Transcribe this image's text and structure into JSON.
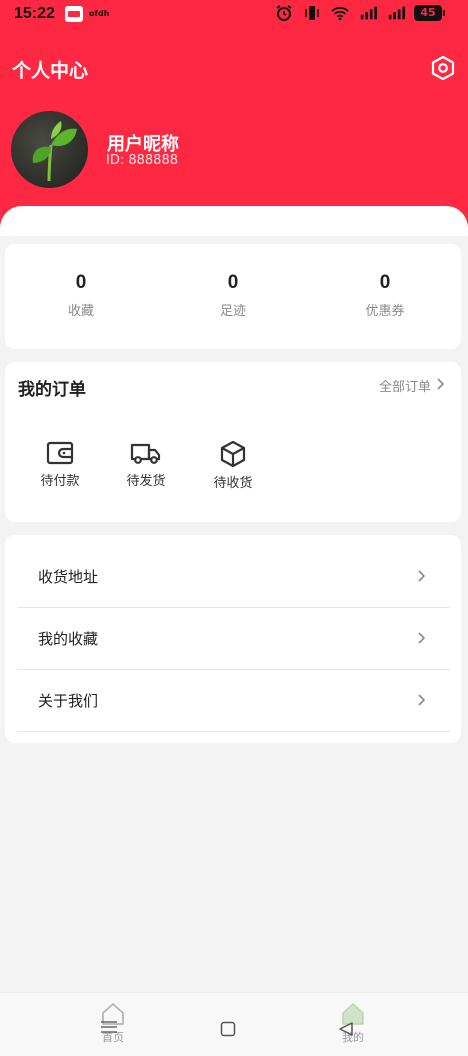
{
  "status_bar": {
    "time": "15:22",
    "mini_text": "ofdh",
    "battery": "45"
  },
  "header": {
    "title": "个人中心",
    "username": "用户昵称",
    "user_id": "ID: 888888",
    "bg_color": "#ff2842"
  },
  "stats": [
    {
      "value": "0",
      "label": "收藏"
    },
    {
      "value": "0",
      "label": "足迹"
    },
    {
      "value": "0",
      "label": "优惠券"
    }
  ],
  "orders": {
    "title": "我的订单",
    "all_label": "全部订单",
    "items": [
      {
        "label": "待付款",
        "icon": "wallet-icon"
      },
      {
        "label": "待发货",
        "icon": "truck-icon"
      },
      {
        "label": "待收货",
        "icon": "box-icon"
      }
    ]
  },
  "menu": [
    {
      "label": "收货地址"
    },
    {
      "label": "我的收藏"
    },
    {
      "label": "关于我们"
    }
  ],
  "tabbar": {
    "home": "首页",
    "mine": "我的"
  }
}
